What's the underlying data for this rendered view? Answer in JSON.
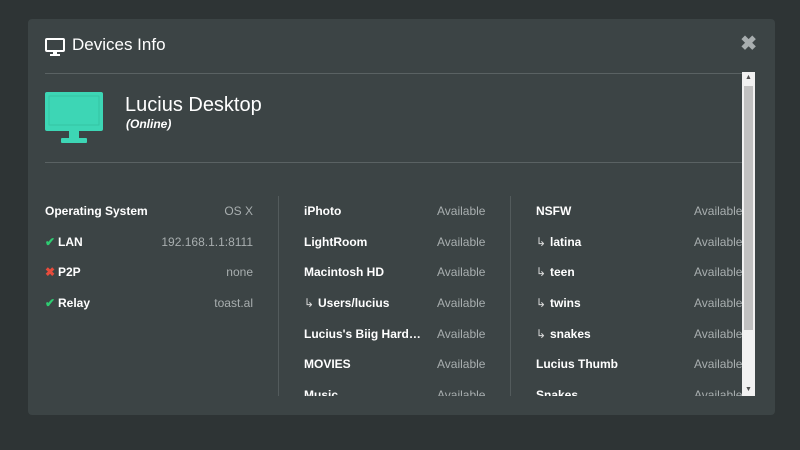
{
  "dialog": {
    "title": "Devices Info",
    "header_icon": "monitor-icon",
    "close_icon": "close-icon",
    "close_glyph": "✖"
  },
  "device": {
    "icon": "desktop-monitor-icon",
    "name": "Lucius Desktop",
    "status": "(Online)",
    "accent_color": "#3dd6b5"
  },
  "system": [
    {
      "label": "Operating System",
      "value": "OS X",
      "status": "none"
    },
    {
      "label": "LAN",
      "value": "192.168.1.1:8111",
      "status": "ok"
    },
    {
      "label": "P2P",
      "value": "none",
      "status": "fail"
    },
    {
      "label": "Relay",
      "value": "toast.al",
      "status": "ok"
    }
  ],
  "folders_left": [
    {
      "label": "iPhoto",
      "value": "Available",
      "sub": false
    },
    {
      "label": "LightRoom",
      "value": "Available",
      "sub": false
    },
    {
      "label": "Macintosh HD",
      "value": "Available",
      "sub": false
    },
    {
      "label": "Users/lucius",
      "value": "Available",
      "sub": true
    },
    {
      "label": "Lucius's Biig Hard…",
      "value": "Available",
      "sub": false
    },
    {
      "label": "MOVIES",
      "value": "Available",
      "sub": false
    },
    {
      "label": "Music",
      "value": "Available",
      "sub": false
    }
  ],
  "folders_right": [
    {
      "label": "NSFW",
      "value": "Available",
      "sub": false
    },
    {
      "label": "latina",
      "value": "Available",
      "sub": true
    },
    {
      "label": "teen",
      "value": "Available",
      "sub": true
    },
    {
      "label": "twins",
      "value": "Available",
      "sub": true
    },
    {
      "label": "snakes",
      "value": "Available",
      "sub": true
    },
    {
      "label": "Lucius Thumb",
      "value": "Available",
      "sub": false
    },
    {
      "label": "Snakes",
      "value": "Available",
      "sub": false
    }
  ],
  "glyphs": {
    "check": "✔",
    "cross": "✖",
    "sub_arrow": "↳",
    "scroll_up": "▲",
    "scroll_down": "▼"
  },
  "colors": {
    "ok": "#2ecc71",
    "fail": "#e74c3c",
    "background": "#2e3435",
    "panel": "#3c4445"
  }
}
